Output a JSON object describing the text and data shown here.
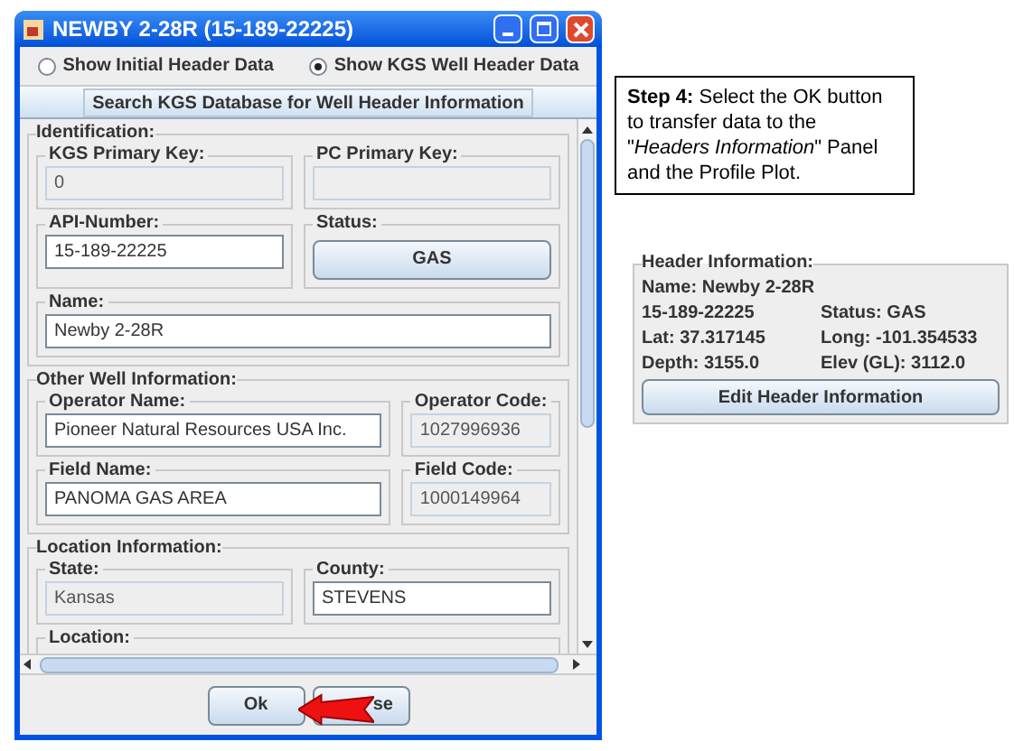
{
  "window": {
    "title": "NEWBY 2-28R (15-189-22225)"
  },
  "radios": [
    {
      "label": "Show Initial Header Data",
      "selected": false
    },
    {
      "label": "Show KGS Well Header Data",
      "selected": true
    }
  ],
  "search_button": "Search KGS Database for Well Header Information",
  "sections": [
    {
      "title": "Identification:",
      "rows": [
        [
          {
            "label": "KGS Primary Key:",
            "value": "0",
            "kind": "readonly"
          },
          {
            "label": "PC Primary Key:",
            "kind": "readonly"
          }
        ],
        [
          {
            "label": "API-Number:",
            "value": "15-189-22225",
            "kind": "text"
          },
          {
            "label": "Status:",
            "value": "GAS",
            "kind": "button"
          }
        ],
        [
          {
            "label": "Name:",
            "value": "Newby 2-28R",
            "kind": "text"
          }
        ]
      ]
    },
    {
      "title": "Other Well Information:",
      "rows": [
        [
          {
            "label": "Operator Name:",
            "value": "Pioneer Natural Resources USA Inc.",
            "kind": "text",
            "wide": true
          },
          {
            "label": "Operator Code:",
            "value": "1027996936",
            "kind": "readonly"
          }
        ],
        [
          {
            "label": "Field Name:",
            "value": "PANOMA GAS AREA",
            "kind": "text",
            "wide": true
          },
          {
            "label": "Field Code:",
            "value": "1000149964",
            "kind": "readonly"
          }
        ]
      ]
    },
    {
      "title": "Location Information:",
      "rows": [
        [
          {
            "label": "State:",
            "value": "Kansas",
            "kind": "readonly"
          },
          {
            "label": "County:",
            "value": "STEVENS",
            "kind": "text"
          }
        ],
        [
          {
            "label": "Location:",
            "kind": "cut"
          }
        ]
      ]
    }
  ],
  "buttons": [
    "Ok",
    "se"
  ],
  "callout": {
    "lead": "Step 4:",
    "text": "Select the OK button to transfer data to the \"*Headers Information*\" Panel and the Profile Plot."
  },
  "header_panel": {
    "title": "Header Information:",
    "lines": [
      [
        "Name: Newby 2-28R"
      ],
      [
        "15-189-22225",
        "Status: GAS"
      ],
      [
        "Lat: 37.317145",
        "Long: -101.354533"
      ],
      [
        "Depth: 3155.0",
        "Elev (GL): 3112.0"
      ]
    ],
    "button": "Edit Header Information"
  }
}
